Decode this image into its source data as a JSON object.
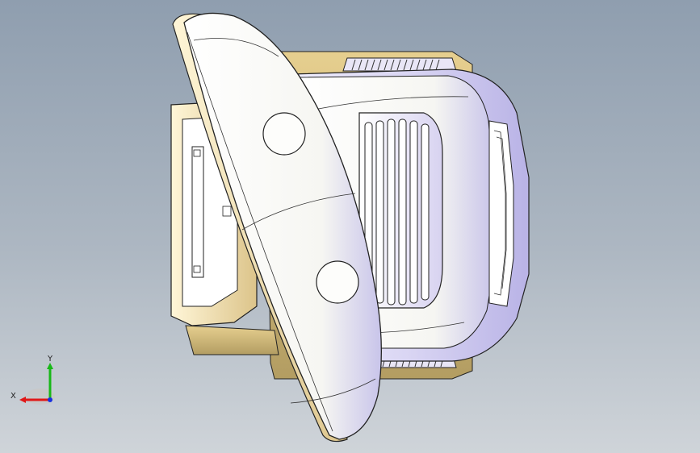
{
  "triad": {
    "x_label": "X",
    "y_label": "Y",
    "colors": {
      "x": "#e01818",
      "y": "#18b818",
      "z": "#1830e0"
    }
  },
  "colors": {
    "background_top": "#8f9eaf",
    "background_bottom": "#cfd4d9",
    "shell": "#fbfbf7",
    "shell_shade": "#c9c6e8",
    "trim": "#f0dca6",
    "edge": "#222222"
  }
}
